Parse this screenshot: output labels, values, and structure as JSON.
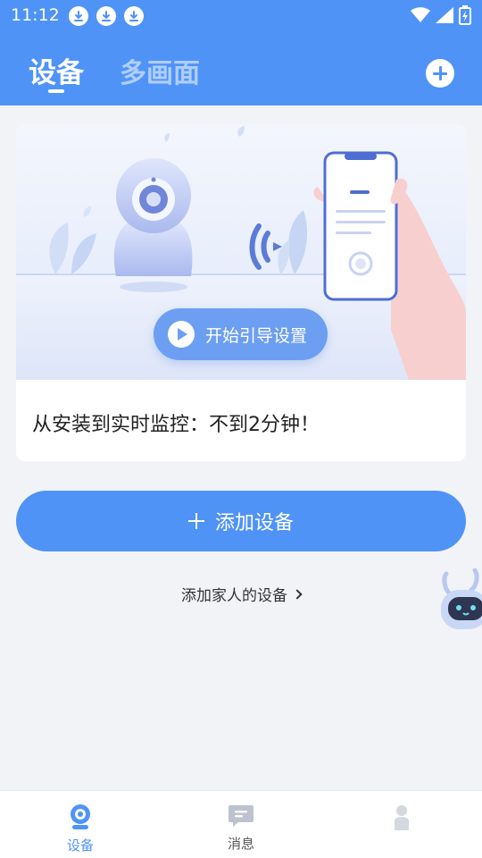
{
  "status_bar": {
    "time": "11:12"
  },
  "header": {
    "tabs": [
      {
        "label": "设备"
      },
      {
        "label": "多画面"
      }
    ]
  },
  "guide_card": {
    "button_label": "开始引导设置",
    "caption": "从安装到实时监控：不到2分钟！"
  },
  "actions": {
    "add_device_label": "添加设备",
    "family_link_label": "添加家人的设备"
  },
  "bottom_nav": {
    "items": [
      {
        "label": "设备",
        "icon": "camera-icon"
      },
      {
        "label": "消息",
        "icon": "message-icon"
      },
      {
        "label": "",
        "icon": "profile-icon"
      }
    ]
  },
  "colors": {
    "primary": "#4f93f7",
    "guide_button": "#6c9ff1",
    "background": "#f2f3f7"
  }
}
